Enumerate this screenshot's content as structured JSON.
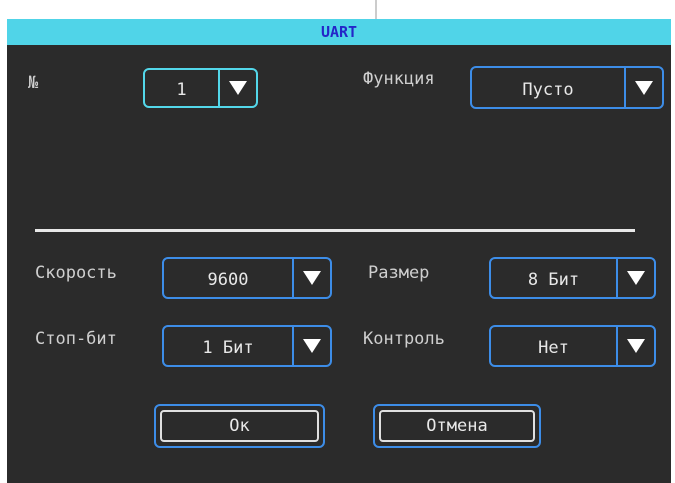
{
  "window": {
    "title": "UART"
  },
  "fields": {
    "number": {
      "label": "№",
      "value": "1"
    },
    "function": {
      "label": "Функция",
      "value": "Пусто"
    },
    "speed": {
      "label": "Скорость",
      "value": "9600"
    },
    "size": {
      "label": "Размер",
      "value": "8 Бит"
    },
    "stop_bits": {
      "label": "Стоп-бит",
      "value": "1 Бит"
    },
    "control": {
      "label": "Контроль",
      "value": "Нет"
    }
  },
  "buttons": {
    "ok": "Ок",
    "cancel": "Отмена"
  },
  "icons": {
    "dropdown": "triangle-down-icon"
  },
  "colors": {
    "title_bg": "#50d4e8",
    "title_text": "#2426c8",
    "accent": "#3d8de8",
    "panel": "#2b2b2b"
  }
}
